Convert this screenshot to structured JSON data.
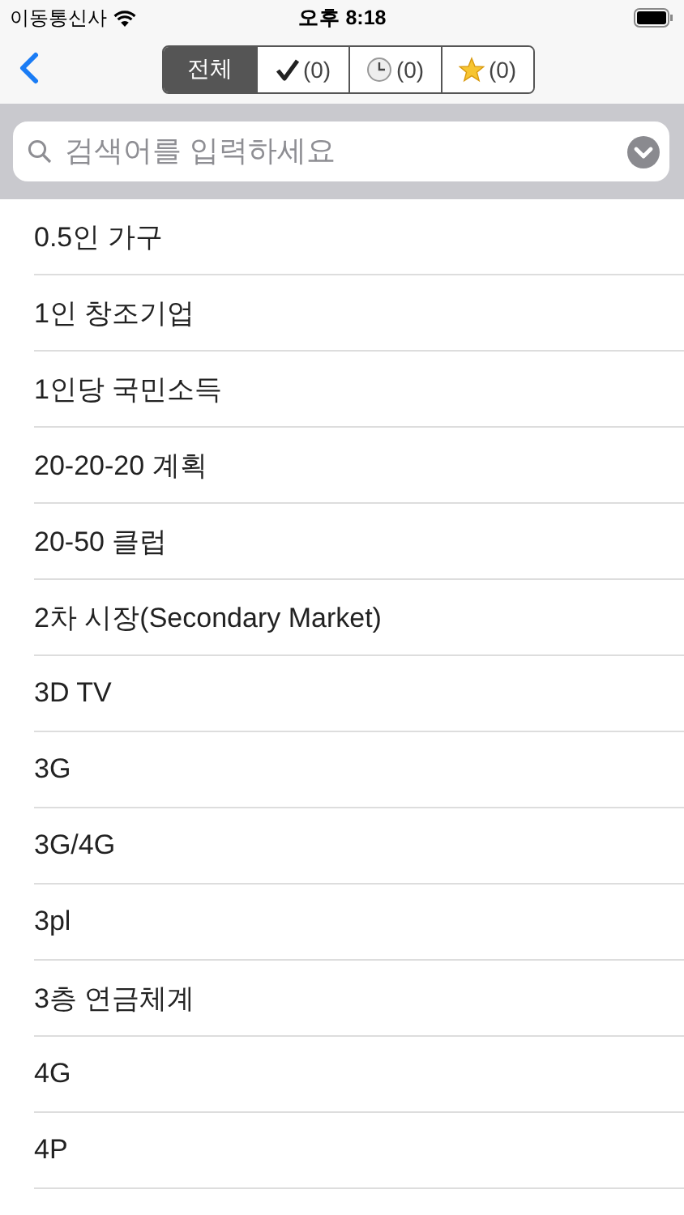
{
  "status_bar": {
    "carrier": "이동통신사",
    "time": "오후 8:18"
  },
  "filter_tabs": [
    {
      "kind": "text",
      "label": "전체",
      "selected": true
    },
    {
      "kind": "check",
      "label": "(0)",
      "selected": false
    },
    {
      "kind": "clock",
      "label": "(0)",
      "selected": false
    },
    {
      "kind": "star",
      "label": "(0)",
      "selected": false
    }
  ],
  "search": {
    "placeholder": "검색어를 입력하세요"
  },
  "terms": [
    "0.5인 가구",
    "1인 창조기업",
    "1인당 국민소득",
    "20-20-20 계획",
    "20-50 클럽",
    "2차 시장(Secondary Market)",
    "3D TV",
    "3G",
    "3G/4G",
    "3pl",
    "3층 연금체계",
    "4G",
    "4P"
  ]
}
